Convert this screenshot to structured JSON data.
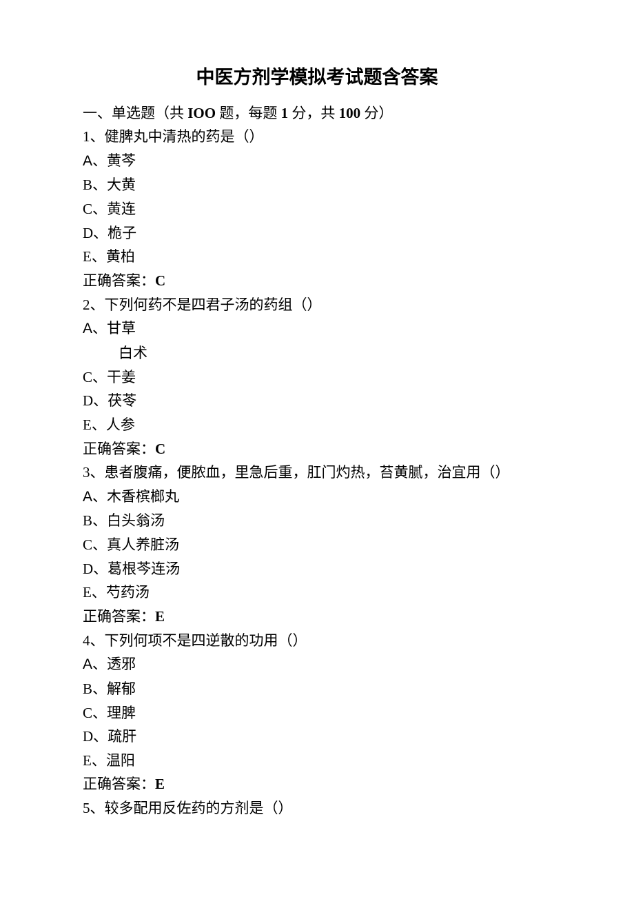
{
  "title": "中医方剂学模拟考试题含答案",
  "section": {
    "prefix": "一、单选题（共 ",
    "count_label": "IOO",
    "mid1": " 题，每题 ",
    "per": "1",
    "mid2": " 分，共 ",
    "total": "100",
    "suffix": " 分）"
  },
  "answer_label": "正确答案：",
  "questions": [
    {
      "num": "1、",
      "text": "健脾丸中清热的药是（）",
      "options": [
        {
          "label": "A",
          "arial": true,
          "sep": "、",
          "text": "黄芩"
        },
        {
          "label": "B",
          "arial": false,
          "sep": "、",
          "text": "大黄"
        },
        {
          "label": "C",
          "arial": false,
          "sep": "、",
          "text": "黄连"
        },
        {
          "label": "D",
          "arial": false,
          "sep": "、",
          "text": "桅子"
        },
        {
          "label": "E",
          "arial": false,
          "sep": "、",
          "text": "黄柏"
        }
      ],
      "answer": "C"
    },
    {
      "num": "2、",
      "text": "下列何药不是四君子汤的药组（）",
      "options": [
        {
          "label": "A",
          "arial": true,
          "sep": "、",
          "text": "甘草"
        },
        {
          "label": "",
          "arial": false,
          "sep": "",
          "text": "白术",
          "indent": true
        },
        {
          "label": "C",
          "arial": false,
          "sep": "、",
          "text": "干姜"
        },
        {
          "label": "D",
          "arial": false,
          "sep": "、",
          "text": "茯苓"
        },
        {
          "label": "E",
          "arial": false,
          "sep": "、",
          "text": "人参"
        }
      ],
      "answer": "C"
    },
    {
      "num": "3、",
      "text": "患者腹痛，便脓血，里急后重，肛门灼热，苔黄腻，治宜用（）",
      "options": [
        {
          "label": "A",
          "arial": true,
          "sep": "、",
          "text": "木香槟榔丸"
        },
        {
          "label": "B",
          "arial": false,
          "sep": "、",
          "text": "白头翁汤"
        },
        {
          "label": "C",
          "arial": false,
          "sep": "、",
          "text": "真人养脏汤"
        },
        {
          "label": "D",
          "arial": false,
          "sep": "、",
          "text": "葛根芩连汤"
        },
        {
          "label": "E",
          "arial": false,
          "sep": "、",
          "text": "芍药汤"
        }
      ],
      "answer": "E"
    },
    {
      "num": "4、",
      "text": "下列何项不是四逆散的功用（）",
      "options": [
        {
          "label": "A",
          "arial": true,
          "sep": "、",
          "text": "透邪"
        },
        {
          "label": "B",
          "arial": false,
          "sep": "、",
          "text": "解郁"
        },
        {
          "label": "C",
          "arial": false,
          "sep": "、",
          "text": "理脾"
        },
        {
          "label": "D",
          "arial": false,
          "sep": "、",
          "text": "疏肝"
        },
        {
          "label": "E",
          "arial": false,
          "sep": "、",
          "text": "温阳"
        }
      ],
      "answer": "E"
    },
    {
      "num": "5、",
      "text": "较多配用反佐药的方剂是（）",
      "options": [],
      "answer": null
    }
  ]
}
